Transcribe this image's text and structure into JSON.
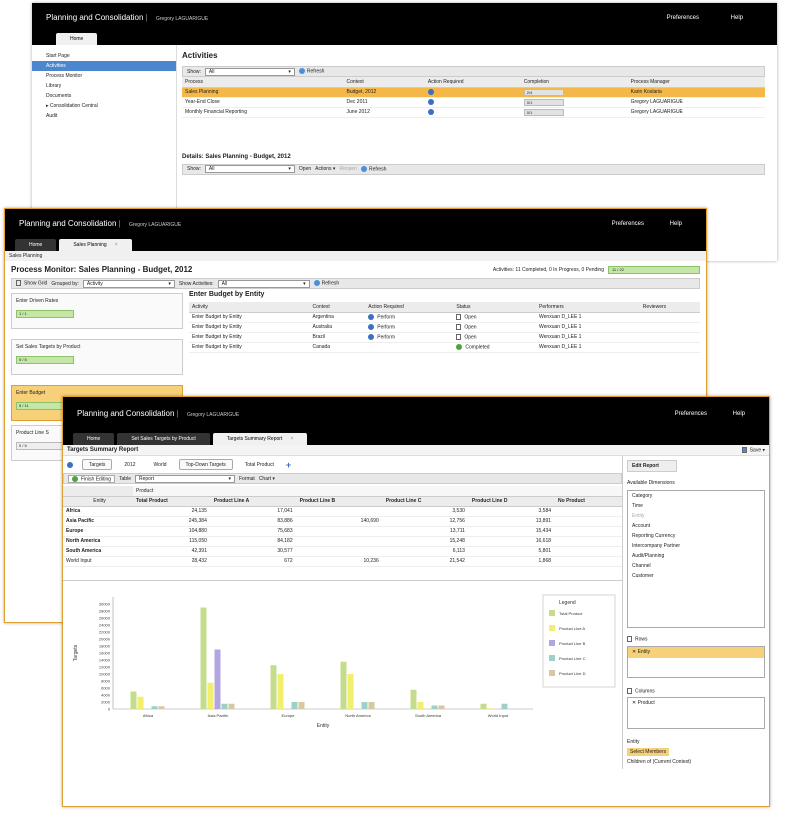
{
  "shell": {
    "app_title": "Planning and Consolidation",
    "user": "Gregory LAGUARIGUE",
    "preferences": "Preferences",
    "help": "Help"
  },
  "w1": {
    "tabs": [
      "Home"
    ],
    "sidebar": [
      "Start Page",
      "Activities",
      "Process Monitor",
      "Library",
      "Documents",
      "Consolidation Central",
      "Audit"
    ],
    "title": "Activities",
    "show_label": "Show:",
    "show_value": "All",
    "refresh": "Refresh",
    "columns": [
      "Process",
      "Context",
      "Action Required",
      "Completion",
      "Process Manager"
    ],
    "rows": [
      [
        "Sales Planning",
        "Budget, 2012",
        "",
        "2/4",
        "Karin Koslaria"
      ],
      [
        "Year-End Close",
        "Dec 2011",
        "",
        "0/1",
        "Gregory LAGUARIGUE"
      ],
      [
        "Monthly Financial Reporting",
        "June 2012",
        "",
        "0/1",
        "Gregory LAGUARIGUE"
      ]
    ],
    "details_title": "Details: Sales Planning - Budget, 2012",
    "details_toolbar": {
      "show": "Show:",
      "show_value": "All",
      "open": "Open",
      "actions": "Actions ▾",
      "reopen": "Reopen",
      "refresh": "Refresh"
    }
  },
  "w2": {
    "tabs": [
      "Home",
      "Sales Planning"
    ],
    "breadcrumb": "Sales Planning",
    "title": "Process Monitor: Sales Planning - Budget, 2012",
    "status": "Activities: 11 Completed, 0 In Progress, 0 Pending",
    "status_progress": "11 / 22",
    "toolbar": {
      "show_grid": "Show Grid",
      "grouped_by": "Grouped by:",
      "grouped_value": "Activity",
      "show_activities": "Show Activities:",
      "show_value": "All",
      "refresh": "Refresh"
    },
    "cards": [
      {
        "label": "Enter Driven Rates",
        "progress": "1 / 1",
        "highlight": false
      },
      {
        "label": "Set Sales Targets by Product",
        "progress": "5 / 5",
        "highlight": false
      },
      {
        "label": "Enter Budget",
        "progress": "5 / 11",
        "highlight": true
      },
      {
        "label": "Product Line S",
        "progress": "0 / 5",
        "highlight": false
      }
    ],
    "section_title": "Enter Budget by Entity",
    "columns": [
      "Activity",
      "Context",
      "Action Required",
      "Status",
      "Performers",
      "Reviewers"
    ],
    "rows": [
      [
        "Enter Budget by Entity",
        "Argentina",
        "Perform",
        "Open",
        "Wenxuan D_LEE 1",
        ""
      ],
      [
        "Enter Budget by Entity",
        "Australia",
        "Perform",
        "Open",
        "Wenxuan D_LEE 1",
        ""
      ],
      [
        "Enter Budget by Entity",
        "Brazil",
        "Perform",
        "Open",
        "Wenxuan D_LEE 1",
        ""
      ],
      [
        "Enter Budget by Entity",
        "Canada",
        "",
        "Completed",
        "Wenxuan D_LEE 1",
        ""
      ]
    ]
  },
  "w3": {
    "tabs": [
      "Home",
      "Set Sales Targets by Product",
      "Targets Summary Report"
    ],
    "report_title": "Targets Summary Report",
    "save": "Save ▾",
    "context_chips": [
      "Targets",
      "2012",
      "World",
      "Top-Down Targets",
      "Total Product"
    ],
    "toolbar": {
      "finish": "Finish Editing",
      "table_label": "Table",
      "table_value": "Report",
      "format": "Format",
      "chart": "Chart ▾"
    },
    "grid_dim_col": "Product",
    "grid_dim_row": "Entity",
    "grid_columns": [
      "Total Product",
      "Product Line A",
      "Product Line B",
      "Product Line C",
      "Product Line D",
      "No Product"
    ],
    "grid_rows": [
      {
        "entity": "Africa",
        "vals": [
          "24,135",
          "17,041",
          "",
          "3,530",
          "3,584",
          ""
        ]
      },
      {
        "entity": "Asia Pacific",
        "vals": [
          "245,384",
          "83,886",
          "140,690",
          "12,756",
          "13,891",
          ""
        ]
      },
      {
        "entity": "Europe",
        "vals": [
          "104,880",
          "75,683",
          "",
          "13,711",
          "15,434",
          ""
        ]
      },
      {
        "entity": "North America",
        "vals": [
          "115,050",
          "84,182",
          "",
          "15,248",
          "16,618",
          ""
        ]
      },
      {
        "entity": "South America",
        "vals": [
          "42,391",
          "30,577",
          "",
          "6,113",
          "5,801",
          ""
        ]
      },
      {
        "entity": "World Input",
        "vals": [
          "28,432",
          "672",
          "10,236",
          "21,542",
          "1,868",
          ""
        ]
      }
    ],
    "chart_data": {
      "type": "bar",
      "categories": [
        "Africa",
        "Asia Pacific",
        "Europe",
        "North America",
        "South America",
        "World Input"
      ],
      "series": [
        {
          "name": "Total Product",
          "values": [
            5000,
            29000,
            12500,
            13500,
            5500,
            1500
          ]
        },
        {
          "name": "Product Line A",
          "values": [
            3500,
            7500,
            10000,
            10000,
            2000,
            200
          ]
        },
        {
          "name": "Product Line B",
          "values": [
            0,
            17000,
            0,
            0,
            0,
            0
          ]
        },
        {
          "name": "Product Line C",
          "values": [
            800,
            1500,
            2000,
            2000,
            1000,
            1500
          ]
        },
        {
          "name": "Product Line D",
          "values": [
            800,
            1500,
            2000,
            2000,
            1000,
            0
          ]
        }
      ],
      "colors": [
        "#c5dc8c",
        "#f2ee6e",
        "#b3a5e0",
        "#9fd0c8",
        "#d4c9a0"
      ],
      "yticks": [
        "30000",
        "28000",
        "26000",
        "24000",
        "22000",
        "20000",
        "18000",
        "16000",
        "14000",
        "12000",
        "10000",
        "8000",
        "6000",
        "4000",
        "2000",
        "0"
      ],
      "ylim": [
        0,
        32000
      ],
      "xlabel": "Entity",
      "ylabel": "Targets",
      "legend_title": "Legend",
      "legend": "top-right"
    },
    "edit_report": {
      "title": "Edit Report",
      "available_label": "Available Dimensions",
      "available": [
        "Category",
        "Time",
        "Entity",
        "Account",
        "Reporting Currency",
        "Intercompany Partner",
        "Audit/Planning",
        "Channel",
        "Customer"
      ],
      "rows_label": "Rows",
      "rows_item": "Entity",
      "columns_label": "Columns",
      "columns_item": "Product",
      "entity_label": "Entity",
      "select_members": "Select Members",
      "children_text": "Children of (Current Context)"
    }
  }
}
